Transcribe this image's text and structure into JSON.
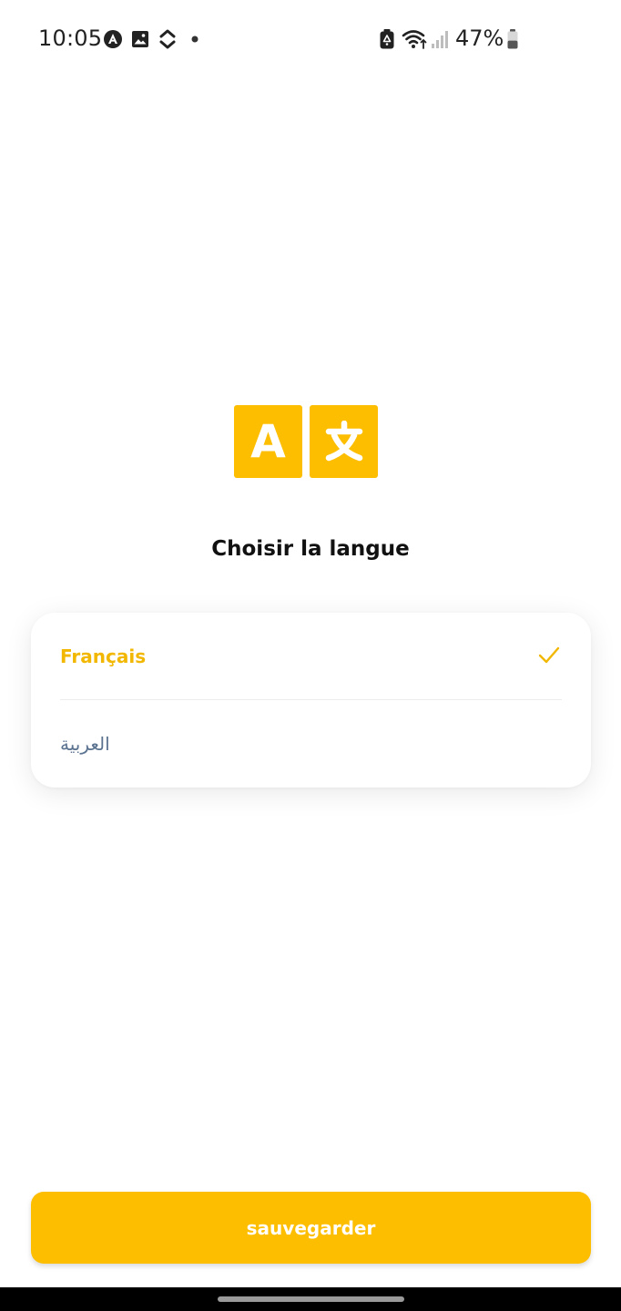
{
  "status_bar": {
    "time": "10:05",
    "battery_percent": "47%",
    "battery_level": 0.47,
    "left_icons": [
      "accessibility-icon",
      "image-icon",
      "sync-icon",
      "dot-icon"
    ],
    "right_icons": [
      "battery-saver-icon",
      "wifi-icon",
      "signal-icon",
      "battery-icon"
    ]
  },
  "logo": {
    "icon": "translate-icon",
    "color": "#FDBE00"
  },
  "title": "Choisir la langue",
  "languages": [
    {
      "label": "Français",
      "selected": true
    },
    {
      "label": "العربية",
      "selected": false
    }
  ],
  "save_button": {
    "label": "sauvegarder"
  },
  "colors": {
    "accent": "#FDBE00",
    "selected_text": "#F2B700",
    "unselected_text": "#5B7390"
  }
}
